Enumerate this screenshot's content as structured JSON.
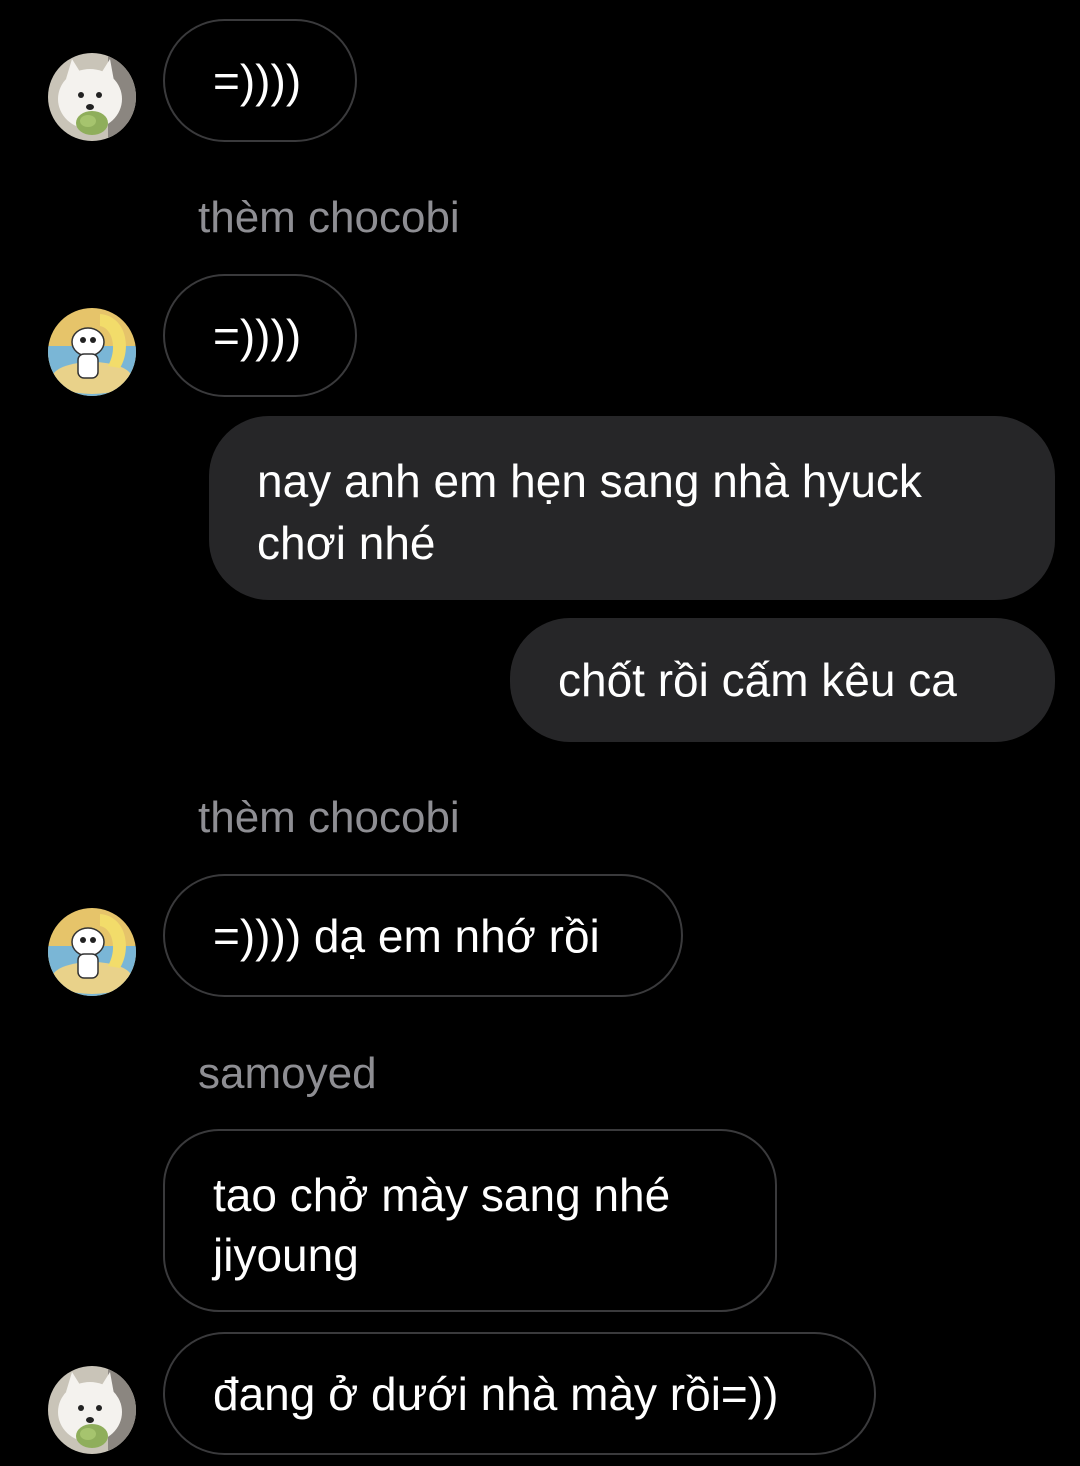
{
  "thread": {
    "messages": [
      {
        "id": "m1",
        "direction": "incoming",
        "sender_label": "",
        "avatar": "samoyed-avatar",
        "text": "=))))"
      },
      {
        "id": "m2",
        "direction": "incoming",
        "sender_label": "thèm chocobi",
        "avatar": "cartoon-avatar",
        "text": "=))))"
      },
      {
        "id": "m3",
        "direction": "outgoing",
        "text": "nay anh em hẹn sang nhà hyuck chơi nhé"
      },
      {
        "id": "m4",
        "direction": "outgoing",
        "text": "chốt rồi cấm kêu ca"
      },
      {
        "id": "m5",
        "direction": "incoming",
        "sender_label": "thèm chocobi",
        "avatar": "cartoon-avatar",
        "text": "=)))) dạ em nhớ rồi"
      },
      {
        "id": "m6",
        "direction": "incoming",
        "sender_label": "samoyed",
        "avatar": "",
        "text": "tao chở mày sang nhé jiyoung"
      },
      {
        "id": "m7",
        "direction": "incoming",
        "sender_label": "",
        "avatar": "samoyed-avatar",
        "text": "đang ở dưới nhà mày rồi=))"
      }
    ]
  },
  "colors": {
    "background": "#000000",
    "incoming_border": "#3a3a3c",
    "outgoing_fill": "#262628",
    "sender_label": "#8e8e93",
    "text": "#ffffff"
  }
}
